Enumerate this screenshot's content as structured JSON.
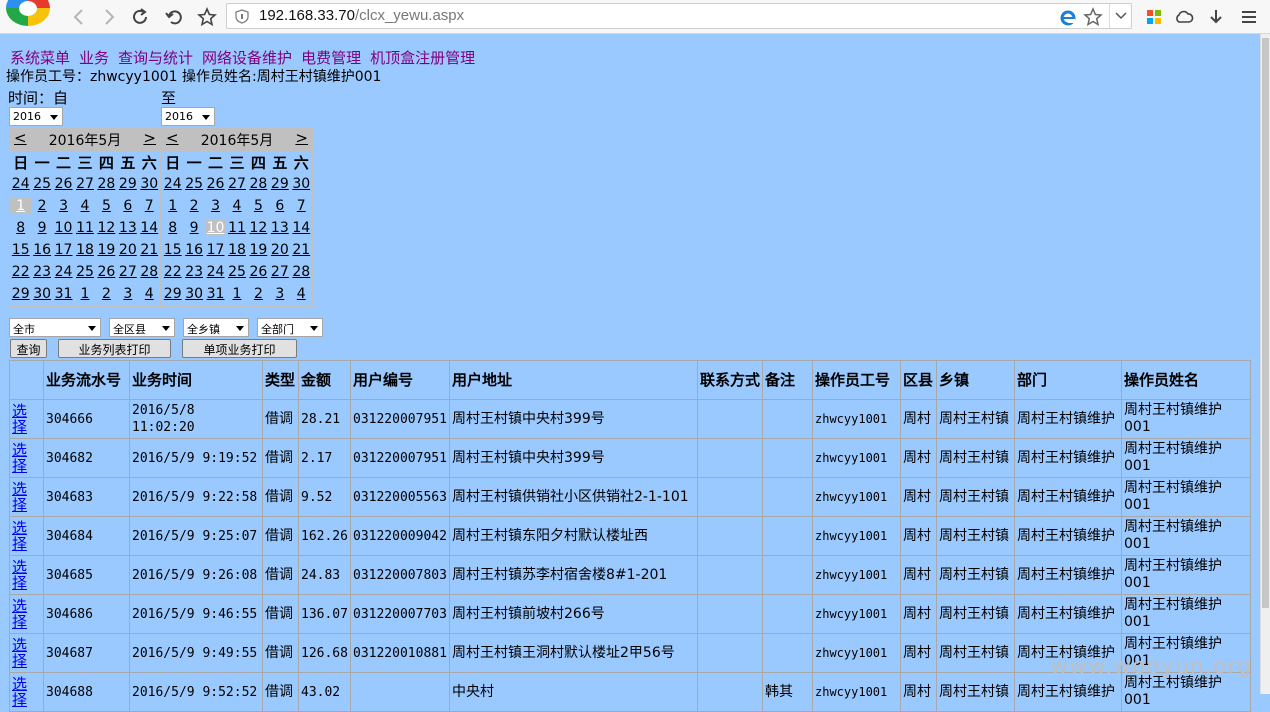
{
  "browser": {
    "url_host": "192.168.33.70",
    "url_path": "/clcx_yewu.aspx"
  },
  "menu": [
    "系统菜单",
    "业务",
    "查询与统计",
    "网络设备维护",
    "电费管理",
    "机顶盒注册管理"
  ],
  "operator_info": "操作员工号：zhwcyy1001 操作员姓名:周村王村镇维护001",
  "time_from_label": "时间：自",
  "time_to_label": "至",
  "year_from": "2016",
  "year_to": "2016",
  "calendars": [
    {
      "prev": "<",
      "next": ">",
      "title": "2016年5月",
      "weekdays": [
        "日",
        "一",
        "二",
        "三",
        "四",
        "五",
        "六"
      ],
      "weeks": [
        [
          "24",
          "25",
          "26",
          "27",
          "28",
          "29",
          "30"
        ],
        [
          "1",
          "2",
          "3",
          "4",
          "5",
          "6",
          "7"
        ],
        [
          "8",
          "9",
          "10",
          "11",
          "12",
          "13",
          "14"
        ],
        [
          "15",
          "16",
          "17",
          "18",
          "19",
          "20",
          "21"
        ],
        [
          "22",
          "23",
          "24",
          "25",
          "26",
          "27",
          "28"
        ],
        [
          "29",
          "30",
          "31",
          "1",
          "2",
          "3",
          "4"
        ]
      ],
      "selected": "1"
    },
    {
      "prev": "<",
      "next": ">",
      "title": "2016年5月",
      "weekdays": [
        "日",
        "一",
        "二",
        "三",
        "四",
        "五",
        "六"
      ],
      "weeks": [
        [
          "24",
          "25",
          "26",
          "27",
          "28",
          "29",
          "30"
        ],
        [
          "1",
          "2",
          "3",
          "4",
          "5",
          "6",
          "7"
        ],
        [
          "8",
          "9",
          "10",
          "11",
          "12",
          "13",
          "14"
        ],
        [
          "15",
          "16",
          "17",
          "18",
          "19",
          "20",
          "21"
        ],
        [
          "22",
          "23",
          "24",
          "25",
          "26",
          "27",
          "28"
        ],
        [
          "29",
          "30",
          "31",
          "1",
          "2",
          "3",
          "4"
        ]
      ],
      "selected": "10"
    }
  ],
  "filters": {
    "city": "全市",
    "county": "全区县",
    "town": "全乡镇",
    "dept": "全部门"
  },
  "buttons": {
    "query": "查询",
    "print_list": "业务列表打印",
    "print_single": "单项业务打印"
  },
  "table": {
    "headers": [
      "",
      "业务流水号",
      "业务时间",
      "类型",
      "金额",
      "用户编号",
      "用户地址",
      "联系方式",
      "备注",
      "操作员工号",
      "区县",
      "乡镇",
      "部门",
      "操作员姓名"
    ],
    "select_label": "选择",
    "rows": [
      [
        "304666",
        "2016/5/8 11:02:20",
        "借调",
        "28.21",
        "031220007951",
        "周村王村镇中央村399号",
        "",
        "",
        "zhwcyy1001",
        "周村",
        "周村王村镇",
        "周村王村镇维护",
        "周村王村镇维护001"
      ],
      [
        "304682",
        "2016/5/9 9:19:52",
        "借调",
        "2.17",
        "031220007951",
        "周村王村镇中央村399号",
        "",
        "",
        "zhwcyy1001",
        "周村",
        "周村王村镇",
        "周村王村镇维护",
        "周村王村镇维护001"
      ],
      [
        "304683",
        "2016/5/9 9:22:58",
        "借调",
        "9.52",
        "031220005563",
        "周村王村镇供销社小区供销社2-1-101",
        "",
        "",
        "zhwcyy1001",
        "周村",
        "周村王村镇",
        "周村王村镇维护",
        "周村王村镇维护001"
      ],
      [
        "304684",
        "2016/5/9 9:25:07",
        "借调",
        "162.26",
        "031220009042",
        "周村王村镇东阳夕村默认楼址西",
        "",
        "",
        "zhwcyy1001",
        "周村",
        "周村王村镇",
        "周村王村镇维护",
        "周村王村镇维护001"
      ],
      [
        "304685",
        "2016/5/9 9:26:08",
        "借调",
        "24.83",
        "031220007803",
        "周村王村镇苏李村宿舍楼8#1-201",
        "",
        "",
        "zhwcyy1001",
        "周村",
        "周村王村镇",
        "周村王村镇维护",
        "周村王村镇维护001"
      ],
      [
        "304686",
        "2016/5/9 9:46:55",
        "借调",
        "136.07",
        "031220007703",
        "周村王村镇前坡村266号",
        "",
        "",
        "zhwcyy1001",
        "周村",
        "周村王村镇",
        "周村王村镇维护",
        "周村王村镇维护001"
      ],
      [
        "304687",
        "2016/5/9 9:49:55",
        "借调",
        "126.68",
        "031220010881",
        "周村王村镇王洞村默认楼址2甲56号",
        "",
        "",
        "zhwcyy1001",
        "周村",
        "周村王村镇",
        "周村王村镇维护",
        "周村王村镇维护001"
      ],
      [
        "304688",
        "2016/5/9 9:52:52",
        "借调",
        "43.02",
        "",
        "中央村",
        "",
        "韩其",
        "zhwcyy1001",
        "周村",
        "周村王村镇",
        "周村王村镇维护",
        "周村王村镇维护001"
      ]
    ]
  },
  "watermark": "www.wooyun.org"
}
